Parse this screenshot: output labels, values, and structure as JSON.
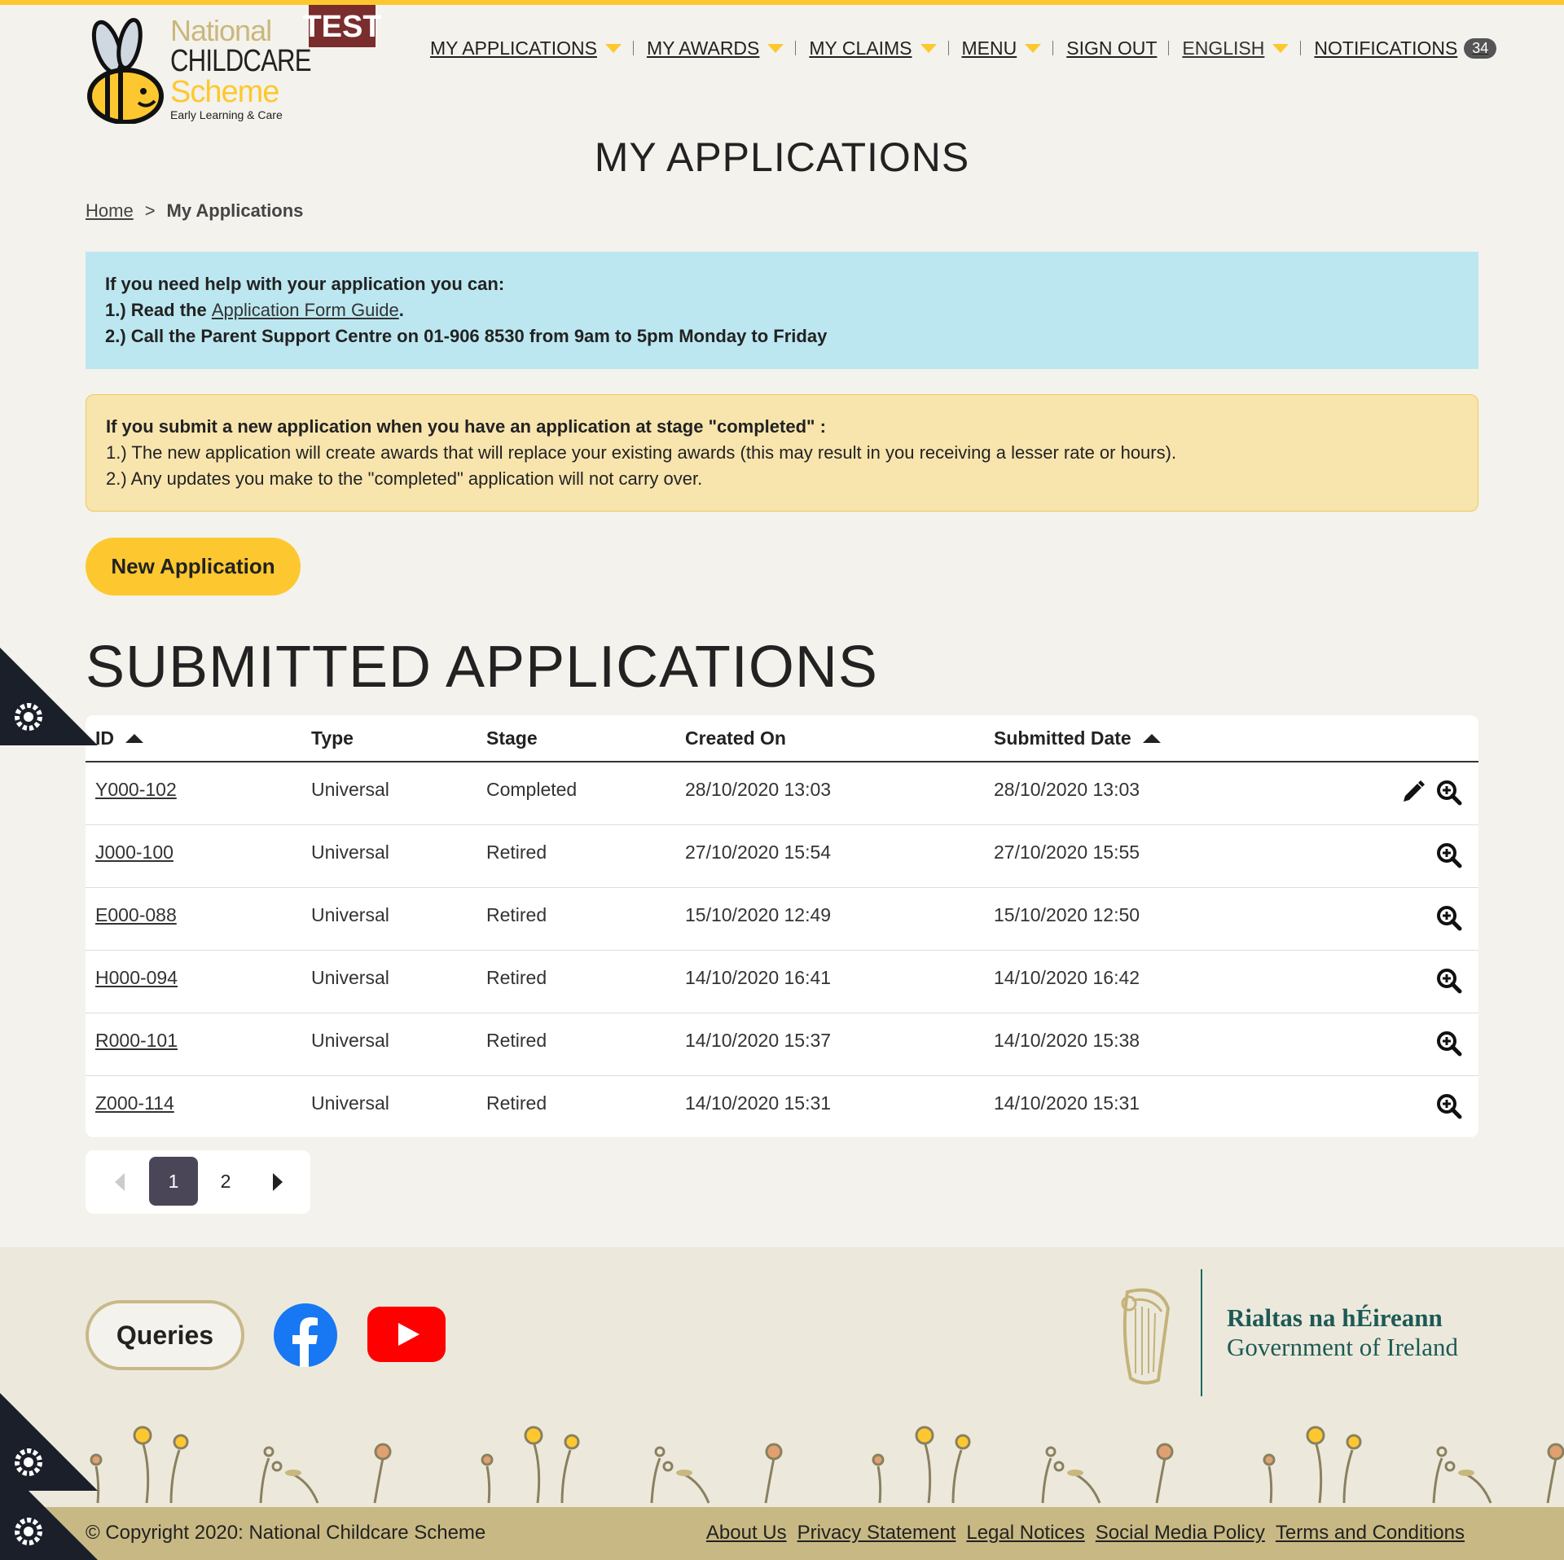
{
  "header": {
    "logo": {
      "line1": "National",
      "line2": "CHILDCARE",
      "line3": "Scheme",
      "line4": "Early Learning & Care"
    },
    "env_badge": "TEST",
    "nav": [
      {
        "label": "MY APPLICATIONS",
        "dropdown": true
      },
      {
        "label": "MY AWARDS",
        "dropdown": true
      },
      {
        "label": "MY CLAIMS",
        "dropdown": true
      },
      {
        "label": "MENU",
        "dropdown": true
      },
      {
        "label": "SIGN OUT",
        "dropdown": false
      },
      {
        "label": "ENGLISH",
        "dropdown": true
      },
      {
        "label": "NOTIFICATIONS",
        "dropdown": false
      }
    ],
    "notifications_count": "34"
  },
  "page_title": "MY APPLICATIONS",
  "breadcrumb": {
    "home": "Home",
    "separator": ">",
    "current": "My Applications"
  },
  "info_box": {
    "heading": "If you need help with your application you can:",
    "line1_prefix": "1.)  Read the ",
    "line1_link": "Application Form Guide",
    "line1_suffix": ".",
    "line2": "2.)  Call the Parent Support Centre on  01-906 8530 from 9am to 5pm Monday to Friday"
  },
  "warning_box": {
    "heading": "If you submit a new application when you have an application at stage \"completed\" :",
    "line1": "1.) The new application will create awards that will replace your existing awards (this may result in you receiving a lesser rate or hours).",
    "line2": "2.) Any updates you make to the \"completed\" application will not carry over."
  },
  "new_application_button": "New Application",
  "section_title": "SUBMITTED APPLICATIONS",
  "table": {
    "columns": [
      "ID",
      "Type",
      "Stage",
      "Created On",
      "Submitted Date"
    ],
    "rows": [
      {
        "id": "Y000-102",
        "type": "Universal",
        "stage": "Completed",
        "created": "28/10/2020 13:03",
        "submitted": "28/10/2020 13:03",
        "editable": true
      },
      {
        "id": "J000-100",
        "type": "Universal",
        "stage": "Retired",
        "created": "27/10/2020 15:54",
        "submitted": "27/10/2020 15:55",
        "editable": false
      },
      {
        "id": "E000-088",
        "type": "Universal",
        "stage": "Retired",
        "created": "15/10/2020 12:49",
        "submitted": "15/10/2020 12:50",
        "editable": false
      },
      {
        "id": "H000-094",
        "type": "Universal",
        "stage": "Retired",
        "created": "14/10/2020 16:41",
        "submitted": "14/10/2020 16:42",
        "editable": false
      },
      {
        "id": "R000-101",
        "type": "Universal",
        "stage": "Retired",
        "created": "14/10/2020 15:37",
        "submitted": "14/10/2020 15:38",
        "editable": false
      },
      {
        "id": "Z000-114",
        "type": "Universal",
        "stage": "Retired",
        "created": "14/10/2020 15:31",
        "submitted": "14/10/2020 15:31",
        "editable": false
      }
    ]
  },
  "pagination": {
    "pages": [
      "1",
      "2"
    ],
    "current": "1"
  },
  "footer": {
    "queries_button": "Queries",
    "gov_irish": "Rialtas na hÉireann",
    "gov_english": "Government of Ireland",
    "copyright": "© Copyright 2020: National Childcare Scheme",
    "links": [
      "About Us",
      "Privacy Statement",
      "Legal Notices",
      "Social Media Policy",
      "Terms and Conditions"
    ]
  },
  "colors": {
    "accent_yellow": "#fdc82f",
    "info_blue": "#bce7f0",
    "warning_cream": "#f8e5ae",
    "footer_tan": "#c8b984",
    "gov_green": "#1d5a55",
    "test_badge": "#7a2d2d"
  },
  "icons": [
    "bee-logo-icon",
    "caret-down-icon",
    "sort-ascending-icon",
    "edit-pencil-icon",
    "zoom-view-icon",
    "facebook-icon",
    "youtube-icon",
    "harp-icon",
    "cookie-settings-icon"
  ]
}
